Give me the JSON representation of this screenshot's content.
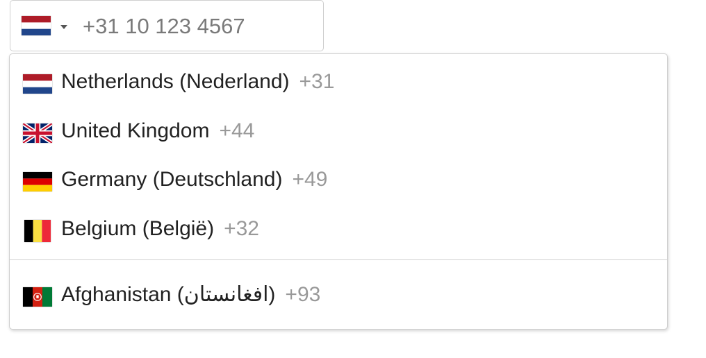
{
  "phone_input": {
    "value": "",
    "placeholder": "+31 10 123 4567",
    "selected_flag": "flag-netherlands-icon"
  },
  "countries": [
    {
      "name": "Netherlands (Nederland)",
      "dial": "+31",
      "flag": "flag-netherlands-icon"
    },
    {
      "name": "United Kingdom",
      "dial": "+44",
      "flag": "flag-united-kingdom-icon"
    },
    {
      "name": "Germany (Deutschland)",
      "dial": "+49",
      "flag": "flag-germany-icon"
    },
    {
      "name": "Belgium (België)",
      "dial": "+32",
      "flag": "flag-belgium-icon"
    },
    {
      "name": "Afghanistan (‫افغانستان‬‎)",
      "dial": "+93",
      "flag": "flag-afghanistan-icon"
    }
  ],
  "colors": {
    "border": "#cfcfcf",
    "dial_code": "#999999",
    "placeholder": "#7a7a7a"
  }
}
